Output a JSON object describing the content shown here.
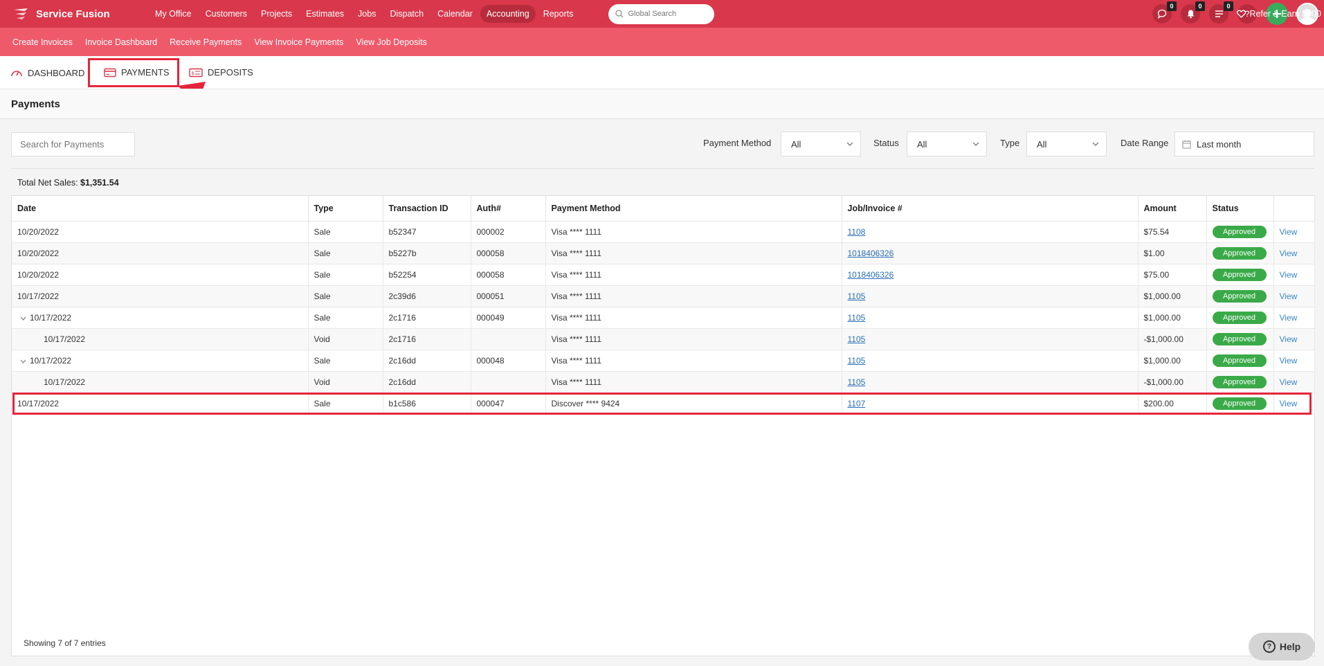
{
  "brand": {
    "name": "Service Fusion"
  },
  "nav": {
    "items": [
      {
        "label": "My Office",
        "active": false
      },
      {
        "label": "Customers",
        "active": false
      },
      {
        "label": "Projects",
        "active": false
      },
      {
        "label": "Estimates",
        "active": false
      },
      {
        "label": "Jobs",
        "active": false
      },
      {
        "label": "Dispatch",
        "active": false
      },
      {
        "label": "Calendar",
        "active": false
      },
      {
        "label": "Accounting",
        "active": true
      },
      {
        "label": "Reports",
        "active": false
      }
    ],
    "search_placeholder": "Global Search",
    "badges": {
      "chat": "0",
      "notifications": "0",
      "tasks": "0"
    },
    "help_icon": "?"
  },
  "subnav": {
    "items": [
      "Create Invoices",
      "Invoice Dashboard",
      "Receive Payments",
      "View Invoice Payments",
      "View Job Deposits"
    ],
    "refer": "Refer & Earn $300"
  },
  "tabs": {
    "dashboard": "DASHBOARD",
    "payments": "PAYMENTS",
    "deposits": "DEPOSITS",
    "active": "payments"
  },
  "page": {
    "title": "Payments"
  },
  "filters": {
    "search_placeholder": "Search for Payments",
    "payment_method_label": "Payment Method",
    "payment_method_value": "All",
    "status_label": "Status",
    "status_value": "All",
    "type_label": "Type",
    "type_value": "All",
    "date_range_label": "Date Range",
    "date_range_value": "Last month"
  },
  "summary": {
    "label": "Total Net Sales:",
    "value": "$1,351.54"
  },
  "table": {
    "headers": {
      "date": "Date",
      "type": "Type",
      "transaction_id": "Transaction ID",
      "auth": "Auth#",
      "payment_method": "Payment Method",
      "invoice": "Job/Invoice #",
      "amount": "Amount",
      "status": "Status"
    },
    "rows": [
      {
        "date": "10/20/2022",
        "level": 0,
        "caret": false,
        "type": "Sale",
        "txn": "b52347",
        "auth": "000002",
        "method": "Visa **** 1111",
        "invoice": "1108",
        "amount": "$75.54",
        "status": "Approved",
        "action": "View"
      },
      {
        "date": "10/20/2022",
        "level": 0,
        "caret": false,
        "type": "Sale",
        "txn": "b5227b",
        "auth": "000058",
        "method": "Visa **** 1111",
        "invoice": "1018406326",
        "amount": "$1.00",
        "status": "Approved",
        "action": "View"
      },
      {
        "date": "10/20/2022",
        "level": 0,
        "caret": false,
        "type": "Sale",
        "txn": "b52254",
        "auth": "000058",
        "method": "Visa **** 1111",
        "invoice": "1018406326",
        "amount": "$75.00",
        "status": "Approved",
        "action": "View"
      },
      {
        "date": "10/17/2022",
        "level": 0,
        "caret": false,
        "type": "Sale",
        "txn": "2c39d6",
        "auth": "000051",
        "method": "Visa **** 1111",
        "invoice": "1105",
        "amount": "$1,000.00",
        "status": "Approved",
        "action": "View"
      },
      {
        "date": "10/17/2022",
        "level": 0,
        "caret": true,
        "type": "Sale",
        "txn": "2c1716",
        "auth": "000049",
        "method": "Visa **** 1111",
        "invoice": "1105",
        "amount": "$1,000.00",
        "status": "Approved",
        "action": "View"
      },
      {
        "date": "10/17/2022",
        "level": 1,
        "caret": false,
        "type": "Void",
        "txn": "2c1716",
        "auth": "",
        "method": "Visa **** 1111",
        "invoice": "1105",
        "amount": "-$1,000.00",
        "status": "Approved",
        "action": "View"
      },
      {
        "date": "10/17/2022",
        "level": 0,
        "caret": true,
        "type": "Sale",
        "txn": "2c16dd",
        "auth": "000048",
        "method": "Visa **** 1111",
        "invoice": "1105",
        "amount": "$1,000.00",
        "status": "Approved",
        "action": "View"
      },
      {
        "date": "10/17/2022",
        "level": 1,
        "caret": false,
        "type": "Void",
        "txn": "2c16dd",
        "auth": "",
        "method": "Visa **** 1111",
        "invoice": "1105",
        "amount": "-$1,000.00",
        "status": "Approved",
        "action": "View"
      },
      {
        "date": "10/17/2022",
        "level": 0,
        "caret": false,
        "type": "Sale",
        "txn": "b1c586",
        "auth": "000047",
        "method": "Discover **** 9424",
        "invoice": "1107",
        "amount": "$200.00",
        "status": "Approved",
        "action": "View"
      }
    ],
    "footer": "Showing 7 of 7 entries"
  },
  "help": {
    "label": "Help"
  },
  "colors": {
    "topbar": "#d9374b",
    "subbar": "#ef5a6b",
    "approved": "#3aaa48",
    "highlight": "#e5243b",
    "link": "#2a6fb5"
  }
}
